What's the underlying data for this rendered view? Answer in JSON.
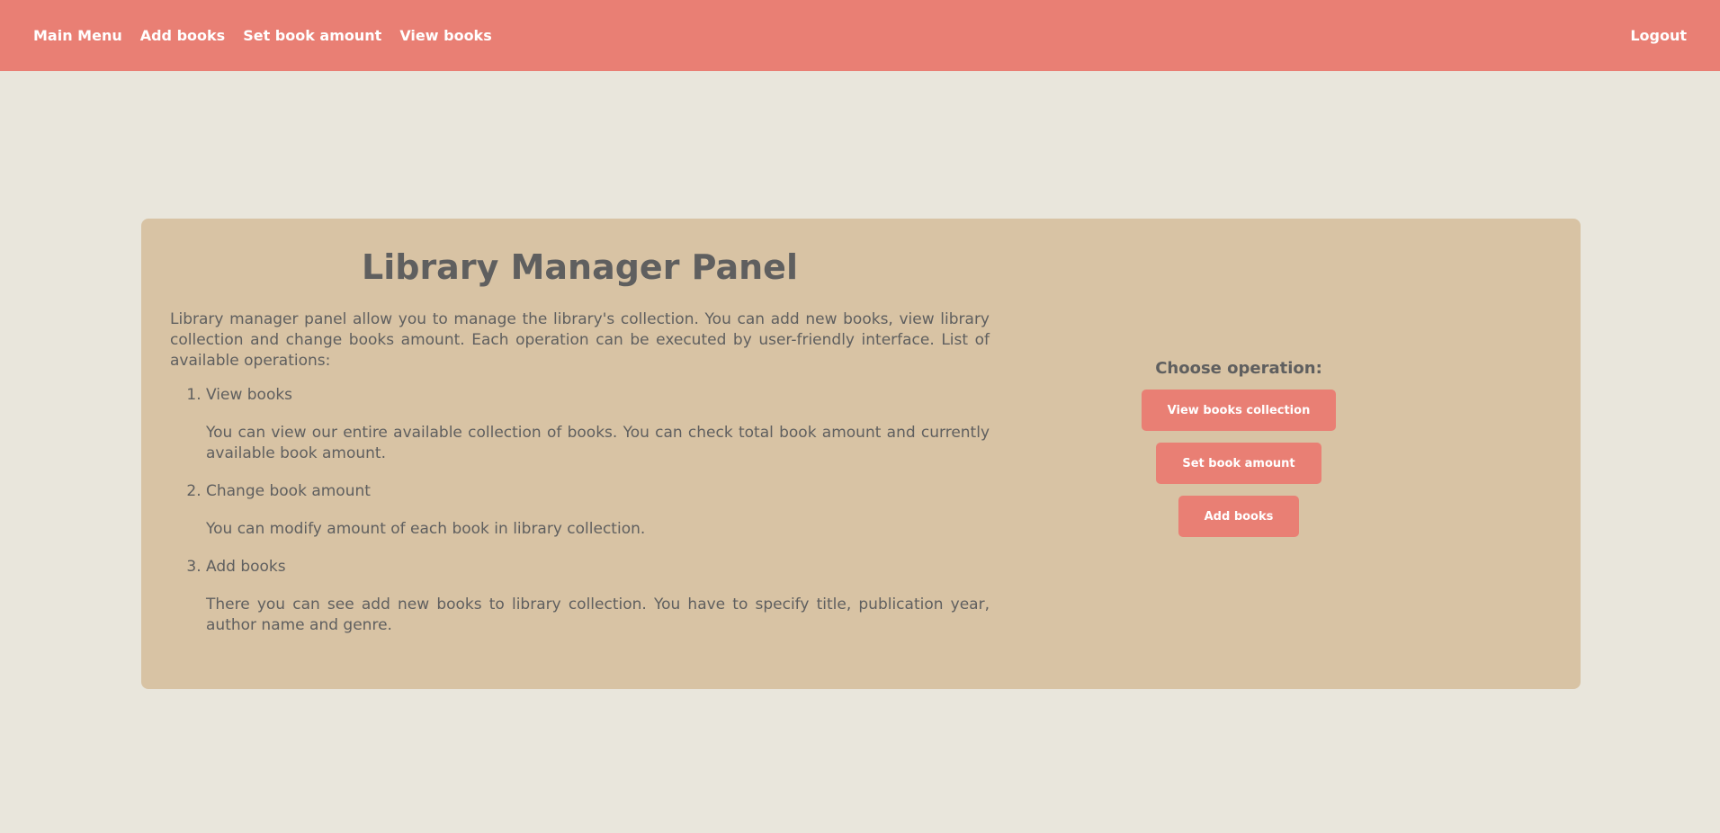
{
  "nav": {
    "items": [
      {
        "label": "Main Menu"
      },
      {
        "label": "Add books"
      },
      {
        "label": "Set book amount"
      },
      {
        "label": "View books"
      }
    ],
    "logout_label": "Logout"
  },
  "panel": {
    "title": "Library Manager Panel",
    "intro": "Library manager panel allow you to manage the library's collection. You can add new books, view library collection and change books amount. Each operation can be executed by user-friendly interface. List of available operations:",
    "operations": [
      {
        "name": "View books",
        "description": "You can view our entire available collection of books. You can check total book amount and currently available book amount."
      },
      {
        "name": "Change book amount",
        "description": "You can modify amount of each book in library collection."
      },
      {
        "name": "Add books",
        "description": "There you can see add new books to library collection. You have to specify title, publication year, author name and genre."
      }
    ]
  },
  "sidebar": {
    "choose_label": "Choose operation:",
    "buttons": [
      {
        "label": "View books collection"
      },
      {
        "label": "Set book amount"
      },
      {
        "label": "Add books"
      }
    ]
  },
  "colors": {
    "accent": "#e97f74",
    "background": "#e9e6dc",
    "panel": "#d8c3a4",
    "text": "#5f5f5f"
  }
}
